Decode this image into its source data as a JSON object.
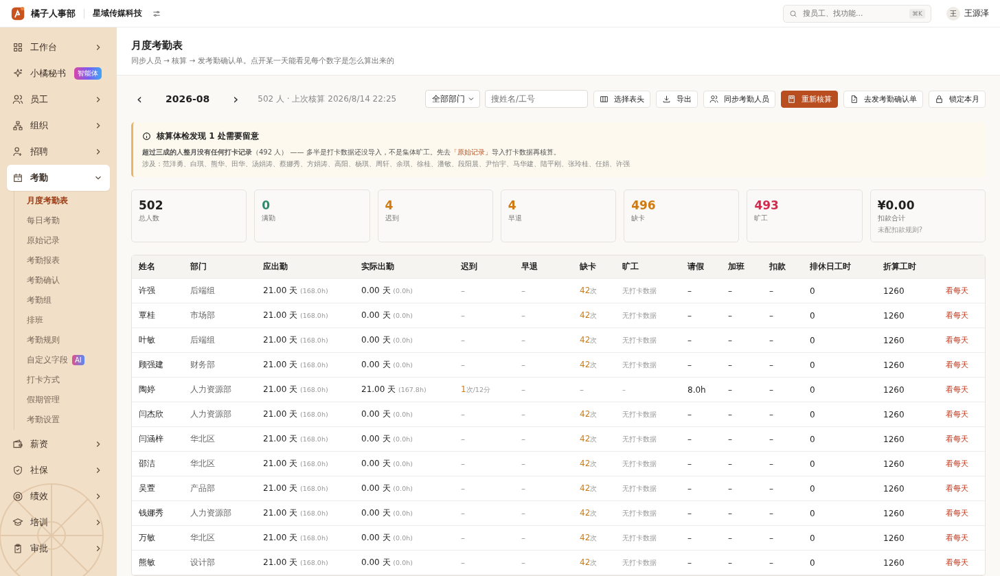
{
  "topbar": {
    "app_name": "橘子人事部",
    "company": "星域传媒科技",
    "search": {
      "placeholder": "搜员工、找功能...",
      "shortcut": "⌘K"
    },
    "user": {
      "avatar": "王",
      "name": "王源泽"
    }
  },
  "sidebar": {
    "items": [
      {
        "label": "工作台",
        "expanded": false,
        "selected": false
      },
      {
        "label": "小橘秘书",
        "badge": "智能体",
        "selected": false
      },
      {
        "label": "员工",
        "expanded": false,
        "selected": false
      },
      {
        "label": "组织",
        "expanded": false,
        "selected": false
      },
      {
        "label": "招聘",
        "expanded": false,
        "selected": false
      },
      {
        "label": "考勤",
        "expanded": true,
        "selected": true,
        "children": [
          {
            "label": "月度考勤表",
            "selected": true
          },
          {
            "label": "每日考勤",
            "selected": false
          },
          {
            "label": "原始记录",
            "selected": false
          },
          {
            "label": "考勤报表",
            "selected": false
          },
          {
            "label": "考勤确认",
            "selected": false
          },
          {
            "label": "考勤组",
            "selected": false
          },
          {
            "label": "排班",
            "selected": false
          },
          {
            "label": "考勤规则",
            "selected": false
          },
          {
            "label": "自定义字段",
            "badge": "AI",
            "selected": false
          },
          {
            "label": "打卡方式",
            "selected": false
          },
          {
            "label": "假期管理",
            "selected": false
          },
          {
            "label": "考勤设置",
            "selected": false
          }
        ]
      },
      {
        "label": "薪资",
        "expanded": false,
        "selected": false
      },
      {
        "label": "社保",
        "expanded": false,
        "selected": false
      },
      {
        "label": "绩效",
        "expanded": false,
        "selected": false
      },
      {
        "label": "培训",
        "expanded": false,
        "selected": false
      },
      {
        "label": "审批",
        "expanded": false,
        "selected": false
      }
    ]
  },
  "page": {
    "title": "月度考勤表",
    "subtitle": "同步人员 → 核算 → 发考勤确认单。点开某一天能看见每个数字是怎么算出来的"
  },
  "toolbar": {
    "prev": "‹",
    "month": "2026-08",
    "next": "›",
    "summary": "502 人 · 上次核算 2026/8/14 22:25",
    "department": "全部部门",
    "search_placeholder": "搜姓名/工号",
    "buttons": [
      {
        "label": "选择表头",
        "kind": "columns",
        "primary": false
      },
      {
        "label": "导出",
        "kind": "export",
        "primary": false
      },
      {
        "label": "同步考勤人员",
        "kind": "users",
        "primary": false
      },
      {
        "label": "重新核算",
        "kind": "calc",
        "primary": true
      },
      {
        "label": "去发考勤确认单",
        "kind": "doc",
        "primary": false
      },
      {
        "label": "锁定本月",
        "kind": "lock",
        "primary": false
      }
    ]
  },
  "alert": {
    "title": "核算体检发现 1 处需要留意",
    "message": "**超过三成的人整月没有任何打卡记录**（492 人） —— 多半是打卡数据还没导入，不是集体旷工。先去",
    "link": "「原始记录」",
    "message_end": "导入打卡数据再核算。",
    "involved": "涉及：范洋勇、白琪、熊华、田华、汤娟涛、蔡娜秀、方娟涛、高阳、杨琪、周轩、余琪、徐桂、潘敏、段阳晨、尹怡宇、马华建、陆平刚、张玲桂、任娟、许强"
  },
  "stats": [
    {
      "value": "502",
      "label": "总人数",
      "color": "#1f1f1f"
    },
    {
      "value": "0",
      "label": "满勤",
      "color": "#2e8b6e"
    },
    {
      "value": "4",
      "label": "迟到",
      "color": "#d07a12"
    },
    {
      "value": "4",
      "label": "早退",
      "color": "#d07a12"
    },
    {
      "value": "496",
      "label": "缺卡",
      "color": "#d07a12"
    },
    {
      "value": "493",
      "label": "旷工",
      "color": "#d42a4e"
    },
    {
      "value": "¥0.00",
      "label": "扣款合计",
      "hint": "未配扣款规则?",
      "color": "#1f1f1f"
    }
  ],
  "table": {
    "columns": [
      "姓名",
      "部门",
      "应出勤",
      "实际出勤",
      "迟到",
      "早退",
      "缺卡",
      "旷工",
      "请假",
      "加班",
      "扣款",
      "排休日工时",
      "折算工时"
    ],
    "rows": [
      {
        "name": "许强",
        "dept": "后端组",
        "due": "21.00 天",
        "due_h": "(168.0h)",
        "actual": "0.00 天",
        "actual_h": "(0.0h)",
        "late": "–",
        "early": "–",
        "missing": "42",
        "missing_unit": "次",
        "absent": "无打卡数据",
        "leave": "–",
        "overtime": "–",
        "deduct": "–",
        "rest": "0",
        "converted": "1260",
        "link": "看每天"
      },
      {
        "name": "覃桂",
        "dept": "市场部",
        "due": "21.00 天",
        "due_h": "(168.0h)",
        "actual": "0.00 天",
        "actual_h": "(0.0h)",
        "late": "–",
        "early": "–",
        "missing": "42",
        "missing_unit": "次",
        "absent": "无打卡数据",
        "leave": "–",
        "overtime": "–",
        "deduct": "–",
        "rest": "0",
        "converted": "1260",
        "link": "看每天"
      },
      {
        "name": "叶敏",
        "dept": "后端组",
        "due": "21.00 天",
        "due_h": "(168.0h)",
        "actual": "0.00 天",
        "actual_h": "(0.0h)",
        "late": "–",
        "early": "–",
        "missing": "42",
        "missing_unit": "次",
        "absent": "无打卡数据",
        "leave": "–",
        "overtime": "–",
        "deduct": "–",
        "rest": "0",
        "converted": "1260",
        "link": "看每天"
      },
      {
        "name": "顾强建",
        "dept": "财务部",
        "due": "21.00 天",
        "due_h": "(168.0h)",
        "actual": "0.00 天",
        "actual_h": "(0.0h)",
        "late": "–",
        "early": "–",
        "missing": "42",
        "missing_unit": "次",
        "absent": "无打卡数据",
        "leave": "–",
        "overtime": "–",
        "deduct": "–",
        "rest": "0",
        "converted": "1260",
        "link": "看每天"
      },
      {
        "name": "陶婷",
        "dept": "人力资源部",
        "due": "21.00 天",
        "due_h": "(168.0h)",
        "actual": "21.00 天",
        "actual_h": "(167.8h)",
        "late": "1",
        "late_unit": "次/12分",
        "early": "–",
        "missing": "–",
        "absent": "–",
        "leave": "8.0h",
        "overtime": "–",
        "deduct": "–",
        "rest": "0",
        "converted": "1260",
        "link": "看每天"
      },
      {
        "name": "闫杰欣",
        "dept": "人力资源部",
        "due": "21.00 天",
        "due_h": "(168.0h)",
        "actual": "0.00 天",
        "actual_h": "(0.0h)",
        "late": "–",
        "early": "–",
        "missing": "42",
        "missing_unit": "次",
        "absent": "无打卡数据",
        "leave": "–",
        "overtime": "–",
        "deduct": "–",
        "rest": "0",
        "converted": "1260",
        "link": "看每天"
      },
      {
        "name": "闫涵梓",
        "dept": "华北区",
        "due": "21.00 天",
        "due_h": "(168.0h)",
        "actual": "0.00 天",
        "actual_h": "(0.0h)",
        "late": "–",
        "early": "–",
        "missing": "42",
        "missing_unit": "次",
        "absent": "无打卡数据",
        "leave": "–",
        "overtime": "–",
        "deduct": "–",
        "rest": "0",
        "converted": "1260",
        "link": "看每天"
      },
      {
        "name": "邵洁",
        "dept": "华北区",
        "due": "21.00 天",
        "due_h": "(168.0h)",
        "actual": "0.00 天",
        "actual_h": "(0.0h)",
        "late": "–",
        "early": "–",
        "missing": "42",
        "missing_unit": "次",
        "absent": "无打卡数据",
        "leave": "–",
        "overtime": "–",
        "deduct": "–",
        "rest": "0",
        "converted": "1260",
        "link": "看每天"
      },
      {
        "name": "吴萱",
        "dept": "产品部",
        "due": "21.00 天",
        "due_h": "(168.0h)",
        "actual": "0.00 天",
        "actual_h": "(0.0h)",
        "late": "–",
        "early": "–",
        "missing": "42",
        "missing_unit": "次",
        "absent": "无打卡数据",
        "leave": "–",
        "overtime": "–",
        "deduct": "–",
        "rest": "0",
        "converted": "1260",
        "link": "看每天"
      },
      {
        "name": "钱娜秀",
        "dept": "人力资源部",
        "due": "21.00 天",
        "due_h": "(168.0h)",
        "actual": "0.00 天",
        "actual_h": "(0.0h)",
        "late": "–",
        "early": "–",
        "missing": "42",
        "missing_unit": "次",
        "absent": "无打卡数据",
        "leave": "–",
        "overtime": "–",
        "deduct": "–",
        "rest": "0",
        "converted": "1260",
        "link": "看每天"
      },
      {
        "name": "万敏",
        "dept": "华北区",
        "due": "21.00 天",
        "due_h": "(168.0h)",
        "actual": "0.00 天",
        "actual_h": "(0.0h)",
        "late": "–",
        "early": "–",
        "missing": "42",
        "missing_unit": "次",
        "absent": "无打卡数据",
        "leave": "–",
        "overtime": "–",
        "deduct": "–",
        "rest": "0",
        "converted": "1260",
        "link": "看每天"
      },
      {
        "name": "熊敏",
        "dept": "设计部",
        "due": "21.00 天",
        "due_h": "(168.0h)",
        "actual": "0.00 天",
        "actual_h": "(0.0h)",
        "late": "–",
        "early": "–",
        "missing": "42",
        "missing_unit": "次",
        "absent": "无打卡数据",
        "leave": "–",
        "overtime": "–",
        "deduct": "–",
        "rest": "0",
        "converted": "1260",
        "link": "看每天"
      }
    ]
  }
}
